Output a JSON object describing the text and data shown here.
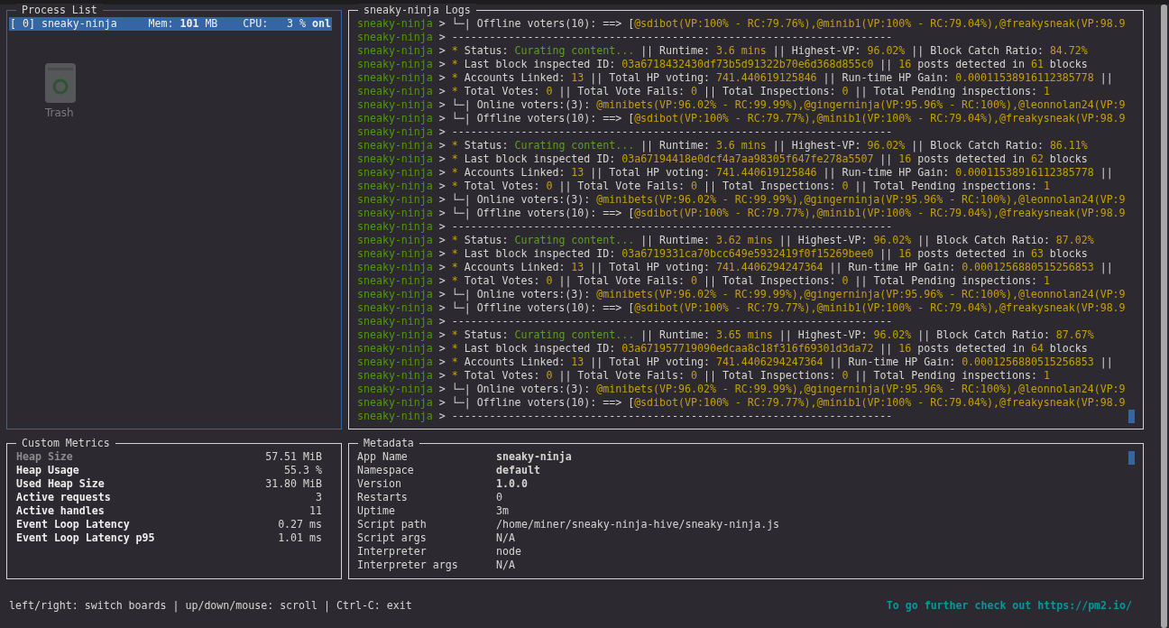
{
  "desktop": {
    "icons": [
      {
        "label": "Trash"
      }
    ]
  },
  "process_list": {
    "title": "Process List",
    "processes": [
      {
        "index": "[ 0]",
        "name": "sneaky-ninja",
        "mem_label": "Mem:",
        "mem": "101",
        "mem_unit": "MB",
        "cpu_label": "CPU:",
        "cpu": "3 %",
        "status": "onl",
        "selected": true
      }
    ]
  },
  "logs": {
    "title": "sneaky-ninja Logs",
    "lines": [
      {
        "segments": [
          {
            "kind": "source",
            "text": "sneaky-ninja"
          },
          {
            "kind": "plain",
            "text": " > └─| Offline voters(10): ==> ["
          },
          {
            "kind": "value",
            "text": "@sdibot(VP:100% - RC:79.76%),@minib1(VP:100% - RC:79.04%),@freakysneak(VP:98.9"
          }
        ]
      },
      {
        "segments": [
          {
            "kind": "source",
            "text": "sneaky-ninja"
          },
          {
            "kind": "plain",
            "text": " > ----------------------------------------------------------------------"
          }
        ]
      },
      {
        "segments": [
          {
            "kind": "source",
            "text": "sneaky-ninja"
          },
          {
            "kind": "plain",
            "text": " > "
          },
          {
            "kind": "value",
            "text": "*"
          },
          {
            "kind": "plain",
            "text": " Status: "
          },
          {
            "kind": "status",
            "text": "Curating content..."
          },
          {
            "kind": "plain",
            "text": " || Runtime: "
          },
          {
            "kind": "value",
            "text": "3.6 mins"
          },
          {
            "kind": "plain",
            "text": " || Highest-VP: "
          },
          {
            "kind": "value",
            "text": "96.02%"
          },
          {
            "kind": "plain",
            "text": " || Block Catch Ratio: "
          },
          {
            "kind": "value",
            "text": "84.72%"
          }
        ]
      },
      {
        "segments": [
          {
            "kind": "source",
            "text": "sneaky-ninja"
          },
          {
            "kind": "plain",
            "text": " > "
          },
          {
            "kind": "value",
            "text": "*"
          },
          {
            "kind": "plain",
            "text": " Last block inspected ID: "
          },
          {
            "kind": "value",
            "text": "03a6718432430df73b5d91322b70e6d368d855c0"
          },
          {
            "kind": "plain",
            "text": " || "
          },
          {
            "kind": "value",
            "text": "16"
          },
          {
            "kind": "plain",
            "text": " posts detected in "
          },
          {
            "kind": "value",
            "text": "61"
          },
          {
            "kind": "plain",
            "text": " blocks"
          }
        ]
      },
      {
        "segments": [
          {
            "kind": "source",
            "text": "sneaky-ninja"
          },
          {
            "kind": "plain",
            "text": " > "
          },
          {
            "kind": "value",
            "text": "*"
          },
          {
            "kind": "plain",
            "text": " Accounts Linked: "
          },
          {
            "kind": "value",
            "text": "13"
          },
          {
            "kind": "plain",
            "text": " || Total HP voting: "
          },
          {
            "kind": "value",
            "text": "741.440619125846"
          },
          {
            "kind": "plain",
            "text": " || Run-time HP Gain: "
          },
          {
            "kind": "value",
            "text": "0.00011538916112385778"
          },
          {
            "kind": "plain",
            "text": " ||"
          }
        ]
      },
      {
        "segments": [
          {
            "kind": "source",
            "text": "sneaky-ninja"
          },
          {
            "kind": "plain",
            "text": " > "
          },
          {
            "kind": "value",
            "text": "*"
          },
          {
            "kind": "plain",
            "text": " Total Votes: "
          },
          {
            "kind": "value",
            "text": "0"
          },
          {
            "kind": "plain",
            "text": " || Total Vote Fails: "
          },
          {
            "kind": "value",
            "text": "0"
          },
          {
            "kind": "plain",
            "text": " || Total Inspections: "
          },
          {
            "kind": "value",
            "text": "0"
          },
          {
            "kind": "plain",
            "text": " || Total Pending inspections: "
          },
          {
            "kind": "value",
            "text": "1"
          }
        ]
      },
      {
        "segments": [
          {
            "kind": "source",
            "text": "sneaky-ninja"
          },
          {
            "kind": "plain",
            "text": " > └─| Online voters:(3): "
          },
          {
            "kind": "value",
            "text": "@minibets(VP:96.02% - RC:99.99%),@gingerninja(VP:95.96% - RC:100%),@leonnolan24(VP:9"
          }
        ]
      },
      {
        "segments": [
          {
            "kind": "source",
            "text": "sneaky-ninja"
          },
          {
            "kind": "plain",
            "text": " > └─| Offline voters(10): ==> ["
          },
          {
            "kind": "value",
            "text": "@sdibot(VP:100% - RC:79.77%),@minib1(VP:100% - RC:79.04%),@freakysneak(VP:98.9"
          }
        ]
      },
      {
        "segments": [
          {
            "kind": "source",
            "text": "sneaky-ninja"
          },
          {
            "kind": "plain",
            "text": " > ----------------------------------------------------------------------"
          }
        ]
      },
      {
        "segments": [
          {
            "kind": "source",
            "text": "sneaky-ninja"
          },
          {
            "kind": "plain",
            "text": " > "
          },
          {
            "kind": "value",
            "text": "*"
          },
          {
            "kind": "plain",
            "text": " Status: "
          },
          {
            "kind": "status",
            "text": "Curating content..."
          },
          {
            "kind": "plain",
            "text": " || Runtime: "
          },
          {
            "kind": "value",
            "text": "3.6 mins"
          },
          {
            "kind": "plain",
            "text": " || Highest-VP: "
          },
          {
            "kind": "value",
            "text": "96.02%"
          },
          {
            "kind": "plain",
            "text": " || Block Catch Ratio: "
          },
          {
            "kind": "value",
            "text": "86.11%"
          }
        ]
      },
      {
        "segments": [
          {
            "kind": "source",
            "text": "sneaky-ninja"
          },
          {
            "kind": "plain",
            "text": " > "
          },
          {
            "kind": "value",
            "text": "*"
          },
          {
            "kind": "plain",
            "text": " Last block inspected ID: "
          },
          {
            "kind": "value",
            "text": "03a67194418e0dcf4a7aa98305f647fe278a5507"
          },
          {
            "kind": "plain",
            "text": " || "
          },
          {
            "kind": "value",
            "text": "16"
          },
          {
            "kind": "plain",
            "text": " posts detected in "
          },
          {
            "kind": "value",
            "text": "62"
          },
          {
            "kind": "plain",
            "text": " blocks"
          }
        ]
      },
      {
        "segments": [
          {
            "kind": "source",
            "text": "sneaky-ninja"
          },
          {
            "kind": "plain",
            "text": " > "
          },
          {
            "kind": "value",
            "text": "*"
          },
          {
            "kind": "plain",
            "text": " Accounts Linked: "
          },
          {
            "kind": "value",
            "text": "13"
          },
          {
            "kind": "plain",
            "text": " || Total HP voting: "
          },
          {
            "kind": "value",
            "text": "741.440619125846"
          },
          {
            "kind": "plain",
            "text": " || Run-time HP Gain: "
          },
          {
            "kind": "value",
            "text": "0.00011538916112385778"
          },
          {
            "kind": "plain",
            "text": " ||"
          }
        ]
      },
      {
        "segments": [
          {
            "kind": "source",
            "text": "sneaky-ninja"
          },
          {
            "kind": "plain",
            "text": " > "
          },
          {
            "kind": "value",
            "text": "*"
          },
          {
            "kind": "plain",
            "text": " Total Votes: "
          },
          {
            "kind": "value",
            "text": "0"
          },
          {
            "kind": "plain",
            "text": " || Total Vote Fails: "
          },
          {
            "kind": "value",
            "text": "0"
          },
          {
            "kind": "plain",
            "text": " || Total Inspections: "
          },
          {
            "kind": "value",
            "text": "0"
          },
          {
            "kind": "plain",
            "text": " || Total Pending inspections: "
          },
          {
            "kind": "value",
            "text": "1"
          }
        ]
      },
      {
        "segments": [
          {
            "kind": "source",
            "text": "sneaky-ninja"
          },
          {
            "kind": "plain",
            "text": " > └─| Online voters:(3): "
          },
          {
            "kind": "value",
            "text": "@minibets(VP:96.02% - RC:99.99%),@gingerninja(VP:95.96% - RC:100%),@leonnolan24(VP:9"
          }
        ]
      },
      {
        "segments": [
          {
            "kind": "source",
            "text": "sneaky-ninja"
          },
          {
            "kind": "plain",
            "text": " > └─| Offline voters(10): ==> ["
          },
          {
            "kind": "value",
            "text": "@sdibot(VP:100% - RC:79.77%),@minib1(VP:100% - RC:79.04%),@freakysneak(VP:98.9"
          }
        ]
      },
      {
        "segments": [
          {
            "kind": "source",
            "text": "sneaky-ninja"
          },
          {
            "kind": "plain",
            "text": " > ----------------------------------------------------------------------"
          }
        ]
      },
      {
        "segments": [
          {
            "kind": "source",
            "text": "sneaky-ninja"
          },
          {
            "kind": "plain",
            "text": " > "
          },
          {
            "kind": "value",
            "text": "*"
          },
          {
            "kind": "plain",
            "text": " Status: "
          },
          {
            "kind": "status",
            "text": "Curating content..."
          },
          {
            "kind": "plain",
            "text": " || Runtime: "
          },
          {
            "kind": "value",
            "text": "3.62 mins"
          },
          {
            "kind": "plain",
            "text": " || Highest-VP: "
          },
          {
            "kind": "value",
            "text": "96.02%"
          },
          {
            "kind": "plain",
            "text": " || Block Catch Ratio: "
          },
          {
            "kind": "value",
            "text": "87.02%"
          }
        ]
      },
      {
        "segments": [
          {
            "kind": "source",
            "text": "sneaky-ninja"
          },
          {
            "kind": "plain",
            "text": " > "
          },
          {
            "kind": "value",
            "text": "*"
          },
          {
            "kind": "plain",
            "text": " Last block inspected ID: "
          },
          {
            "kind": "value",
            "text": "03a6719331ca70bcc649e5932419f0f15269bee0"
          },
          {
            "kind": "plain",
            "text": " || "
          },
          {
            "kind": "value",
            "text": "16"
          },
          {
            "kind": "plain",
            "text": " posts detected in "
          },
          {
            "kind": "value",
            "text": "63"
          },
          {
            "kind": "plain",
            "text": " blocks"
          }
        ]
      },
      {
        "segments": [
          {
            "kind": "source",
            "text": "sneaky-ninja"
          },
          {
            "kind": "plain",
            "text": " > "
          },
          {
            "kind": "value",
            "text": "*"
          },
          {
            "kind": "plain",
            "text": " Accounts Linked: "
          },
          {
            "kind": "value",
            "text": "13"
          },
          {
            "kind": "plain",
            "text": " || Total HP voting: "
          },
          {
            "kind": "value",
            "text": "741.4406294247364"
          },
          {
            "kind": "plain",
            "text": " || Run-time HP Gain: "
          },
          {
            "kind": "value",
            "text": "0.0001256880515256853"
          },
          {
            "kind": "plain",
            "text": " ||"
          }
        ]
      },
      {
        "segments": [
          {
            "kind": "source",
            "text": "sneaky-ninja"
          },
          {
            "kind": "plain",
            "text": " > "
          },
          {
            "kind": "value",
            "text": "*"
          },
          {
            "kind": "plain",
            "text": " Total Votes: "
          },
          {
            "kind": "value",
            "text": "0"
          },
          {
            "kind": "plain",
            "text": " || Total Vote Fails: "
          },
          {
            "kind": "value",
            "text": "0"
          },
          {
            "kind": "plain",
            "text": " || Total Inspections: "
          },
          {
            "kind": "value",
            "text": "0"
          },
          {
            "kind": "plain",
            "text": " || Total Pending inspections: "
          },
          {
            "kind": "value",
            "text": "1"
          }
        ]
      },
      {
        "segments": [
          {
            "kind": "source",
            "text": "sneaky-ninja"
          },
          {
            "kind": "plain",
            "text": " > └─| Online voters:(3): "
          },
          {
            "kind": "value",
            "text": "@minibets(VP:96.02% - RC:99.99%),@gingerninja(VP:95.96% - RC:100%),@leonnolan24(VP:9"
          }
        ]
      },
      {
        "segments": [
          {
            "kind": "source",
            "text": "sneaky-ninja"
          },
          {
            "kind": "plain",
            "text": " > └─| Offline voters(10): ==> ["
          },
          {
            "kind": "value",
            "text": "@sdibot(VP:100% - RC:79.77%),@minib1(VP:100% - RC:79.04%),@freakysneak(VP:98.9"
          }
        ]
      },
      {
        "segments": [
          {
            "kind": "source",
            "text": "sneaky-ninja"
          },
          {
            "kind": "plain",
            "text": " > ----------------------------------------------------------------------"
          }
        ]
      },
      {
        "segments": [
          {
            "kind": "source",
            "text": "sneaky-ninja"
          },
          {
            "kind": "plain",
            "text": " > "
          },
          {
            "kind": "value",
            "text": "*"
          },
          {
            "kind": "plain",
            "text": " Status: "
          },
          {
            "kind": "status",
            "text": "Curating content..."
          },
          {
            "kind": "plain",
            "text": " || Runtime: "
          },
          {
            "kind": "value",
            "text": "3.65 mins"
          },
          {
            "kind": "plain",
            "text": " || Highest-VP: "
          },
          {
            "kind": "value",
            "text": "96.02%"
          },
          {
            "kind": "plain",
            "text": " || Block Catch Ratio: "
          },
          {
            "kind": "value",
            "text": "87.67%"
          }
        ]
      },
      {
        "segments": [
          {
            "kind": "source",
            "text": "sneaky-ninja"
          },
          {
            "kind": "plain",
            "text": " > "
          },
          {
            "kind": "value",
            "text": "*"
          },
          {
            "kind": "plain",
            "text": " Last block inspected ID: "
          },
          {
            "kind": "value",
            "text": "03a671957719090edcaa8c18f316f69301d3da72"
          },
          {
            "kind": "plain",
            "text": " || "
          },
          {
            "kind": "value",
            "text": "16"
          },
          {
            "kind": "plain",
            "text": " posts detected in "
          },
          {
            "kind": "value",
            "text": "64"
          },
          {
            "kind": "plain",
            "text": " blocks"
          }
        ]
      },
      {
        "segments": [
          {
            "kind": "source",
            "text": "sneaky-ninja"
          },
          {
            "kind": "plain",
            "text": " > "
          },
          {
            "kind": "value",
            "text": "*"
          },
          {
            "kind": "plain",
            "text": " Accounts Linked: "
          },
          {
            "kind": "value",
            "text": "13"
          },
          {
            "kind": "plain",
            "text": " || Total HP voting: "
          },
          {
            "kind": "value",
            "text": "741.4406294247364"
          },
          {
            "kind": "plain",
            "text": " || Run-time HP Gain: "
          },
          {
            "kind": "value",
            "text": "0.0001256880515256853"
          },
          {
            "kind": "plain",
            "text": " ||"
          }
        ]
      },
      {
        "segments": [
          {
            "kind": "source",
            "text": "sneaky-ninja"
          },
          {
            "kind": "plain",
            "text": " > "
          },
          {
            "kind": "value",
            "text": "*"
          },
          {
            "kind": "plain",
            "text": " Total Votes: "
          },
          {
            "kind": "value",
            "text": "0"
          },
          {
            "kind": "plain",
            "text": " || Total Vote Fails: "
          },
          {
            "kind": "value",
            "text": "0"
          },
          {
            "kind": "plain",
            "text": " || Total Inspections: "
          },
          {
            "kind": "value",
            "text": "0"
          },
          {
            "kind": "plain",
            "text": " || Total Pending inspections: "
          },
          {
            "kind": "value",
            "text": "1"
          }
        ]
      },
      {
        "segments": [
          {
            "kind": "source",
            "text": "sneaky-ninja"
          },
          {
            "kind": "plain",
            "text": " > └─| Online voters:(3): "
          },
          {
            "kind": "value",
            "text": "@minibets(VP:96.02% - RC:99.99%),@gingerninja(VP:95.96% - RC:100%),@leonnolan24(VP:9"
          }
        ]
      },
      {
        "segments": [
          {
            "kind": "source",
            "text": "sneaky-ninja"
          },
          {
            "kind": "plain",
            "text": " > └─| Offline voters(10): ==> ["
          },
          {
            "kind": "value",
            "text": "@sdibot(VP:100% - RC:79.77%),@minib1(VP:100% - RC:79.04%),@freakysneak(VP:98.9"
          }
        ]
      },
      {
        "segments": [
          {
            "kind": "source",
            "text": "sneaky-ninja"
          },
          {
            "kind": "plain",
            "text": " > ----------------------------------------------------------------------"
          }
        ]
      }
    ]
  },
  "custom_metrics": {
    "title": "Custom Metrics",
    "metrics": [
      {
        "label": "Heap Size",
        "value": "57.51 MiB",
        "selected": true
      },
      {
        "label": "Heap Usage",
        "value": "55.3 %",
        "selected": false
      },
      {
        "label": "Used Heap Size",
        "value": "31.80 MiB",
        "selected": false
      },
      {
        "label": "Active requests",
        "value": "3",
        "selected": false
      },
      {
        "label": "Active handles",
        "value": "11",
        "selected": false
      },
      {
        "label": "Event Loop Latency",
        "value": "0.27 ms",
        "selected": false
      },
      {
        "label": "Event Loop Latency p95",
        "value": "1.01 ms",
        "selected": false
      }
    ]
  },
  "metadata": {
    "title": "Metadata",
    "items": [
      {
        "label": "App Name",
        "value": "sneaky-ninja",
        "bold": true
      },
      {
        "label": "Namespace",
        "value": "default",
        "bold": true
      },
      {
        "label": "Version",
        "value": "1.0.0",
        "bold": true
      },
      {
        "label": "Restarts",
        "value": "0",
        "bold": false
      },
      {
        "label": "Uptime",
        "value": "3m",
        "bold": false
      },
      {
        "label": "Script path",
        "value": "/home/miner/sneaky-ninja-hive/sneaky-ninja.js",
        "bold": false
      },
      {
        "label": "Script args",
        "value": "N/A",
        "bold": false
      },
      {
        "label": "Interpreter",
        "value": "node",
        "bold": false
      },
      {
        "label": "Interpreter args",
        "value": "N/A",
        "bold": false
      }
    ]
  },
  "status_bar": {
    "help": "left/right: switch boards | up/down/mouse: scroll | Ctrl-C: exit",
    "link": "To go further check out https://pm2.io/"
  }
}
